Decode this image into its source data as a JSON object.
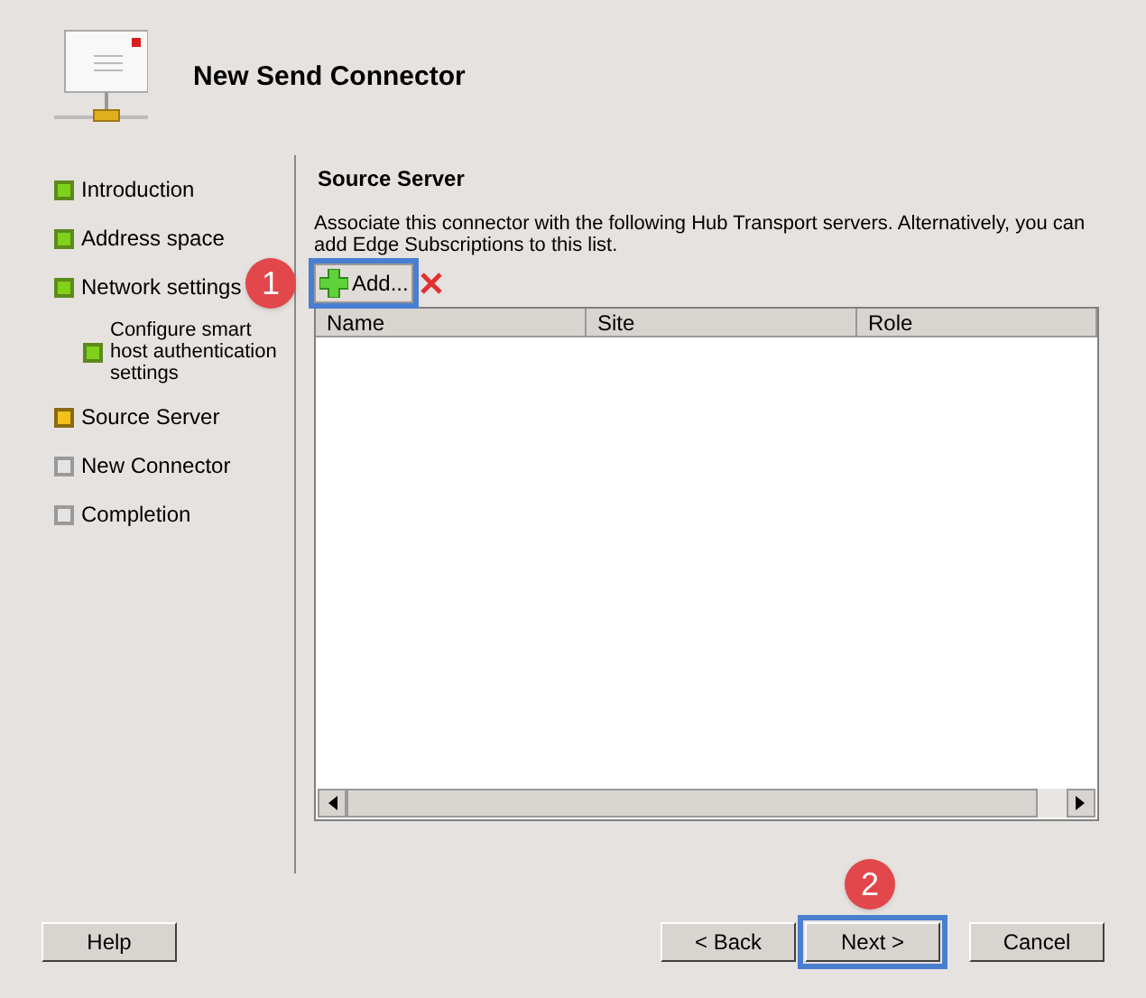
{
  "window": {
    "title": "New Send Connector"
  },
  "steps": [
    {
      "label": "Introduction",
      "kind": "done"
    },
    {
      "label": "Address space",
      "kind": "done"
    },
    {
      "label": "Network settings",
      "kind": "done",
      "children": [
        {
          "label": "Configure smart host authentication settings",
          "kind": "done"
        }
      ]
    },
    {
      "label": "Source Server",
      "kind": "current"
    },
    {
      "label": "New Connector",
      "kind": "pending"
    },
    {
      "label": "Completion",
      "kind": "pending"
    }
  ],
  "page": {
    "heading": "Source Server",
    "description": "Associate this connector with the following Hub Transport servers. Alternatively, you can add Edge Subscriptions to this list.",
    "add_button": "Add...",
    "table": {
      "columns": [
        "Name",
        "Site",
        "Role"
      ]
    }
  },
  "callouts": [
    "1",
    "2"
  ],
  "buttons": {
    "help": "Help",
    "back": "< Back",
    "next": "Next >",
    "cancel": "Cancel"
  }
}
